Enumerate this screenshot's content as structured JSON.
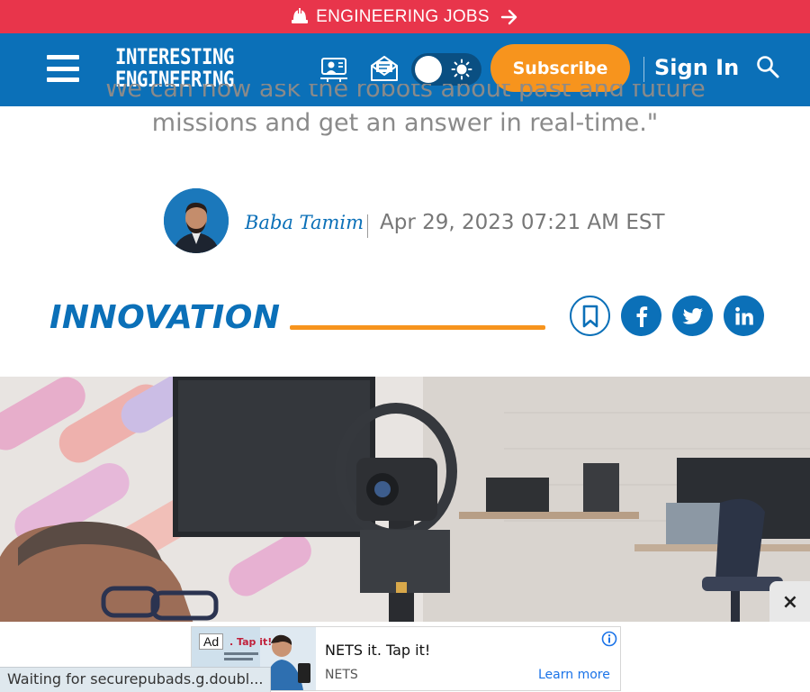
{
  "banner": {
    "label": "ENGINEERING JOBS",
    "icon": "hard-hat-icon",
    "arrow_icon": "arrow-right-icon"
  },
  "header": {
    "logo_line1": "INTERESTING",
    "logo_line2": "ENGINEERING",
    "subscribe_label": "Subscribe",
    "signin_label": "Sign In",
    "icons": [
      "webinar-icon",
      "newsletter-icon",
      "theme-toggle",
      "search-icon"
    ]
  },
  "article": {
    "quote_line1": "We can now ask the robots about past and future",
    "quote_line2": "missions and get an answer in real-time.\"",
    "author": "Baba Tamim",
    "date": "Apr 29, 2023 07:21 AM EST",
    "category": "INNOVATION"
  },
  "share": [
    "bookmark-icon",
    "facebook-icon",
    "twitter-icon",
    "linkedin-icon"
  ],
  "ad": {
    "badge": "Ad",
    "headline": "NETS it. Tap it!",
    "brand": "NETS",
    "cta": "Learn more",
    "close_label": "×",
    "image_text": ". Tap it!"
  },
  "status": {
    "text": "Waiting for securepubads.g.doubl..."
  },
  "colors": {
    "brand_blue": "#0b70b8",
    "accent_orange": "#f7941d",
    "jobs_red": "#e8354b"
  }
}
